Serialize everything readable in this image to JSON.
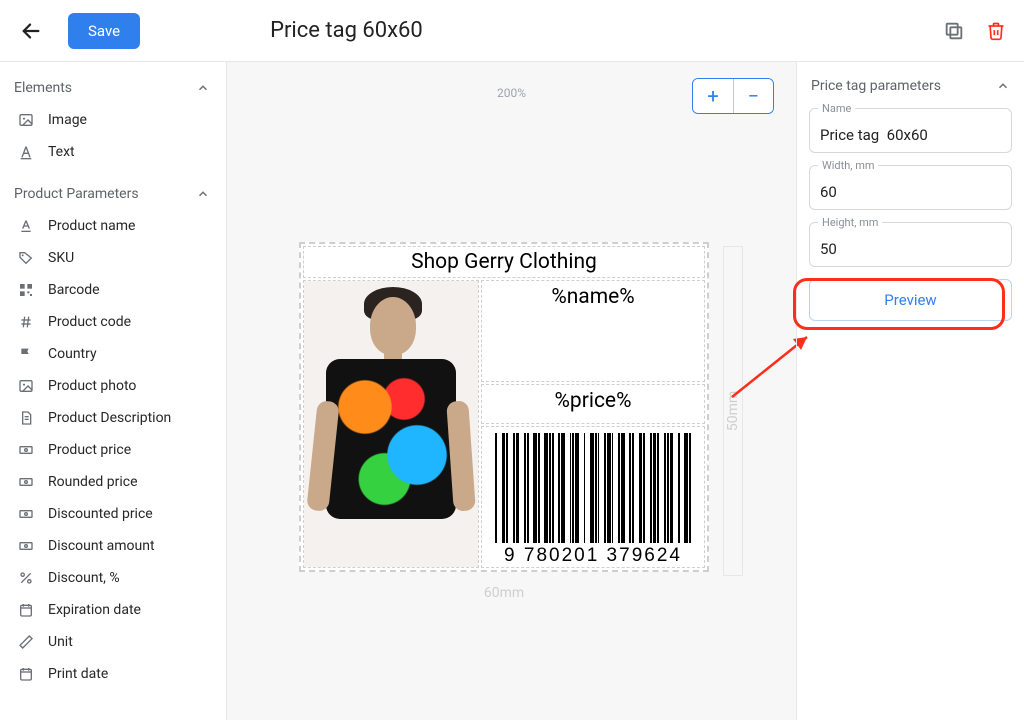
{
  "header": {
    "save_label": "Save",
    "title": "Price tag 60x60"
  },
  "sidebar": {
    "sections": {
      "elements": {
        "title": "Elements",
        "items": [
          "Image",
          "Text"
        ]
      },
      "product_params": {
        "title": "Product Parameters",
        "items": [
          "Product name",
          "SKU",
          "Barcode",
          "Product code",
          "Country",
          "Product photo",
          "Product Description",
          "Product price",
          "Rounded price",
          "Discounted price",
          "Discount amount",
          "Discount, %",
          "Expiration date",
          "Unit",
          "Print date"
        ]
      }
    }
  },
  "canvas": {
    "zoom": "200%",
    "width_ruler": "60mm",
    "height_ruler": "50mm",
    "cells": {
      "shop_title": "Shop Gerry Clothing",
      "name_placeholder": "%name%",
      "price_placeholder": "%price%",
      "barcode_digits": "9  780201  379624"
    }
  },
  "params_panel": {
    "title": "Price tag parameters",
    "name_label": "Name",
    "name_value": "Price tag  60x60",
    "width_label": "Width, mm",
    "width_value": "60",
    "height_label": "Height, mm",
    "height_value": "50",
    "preview_label": "Preview"
  }
}
